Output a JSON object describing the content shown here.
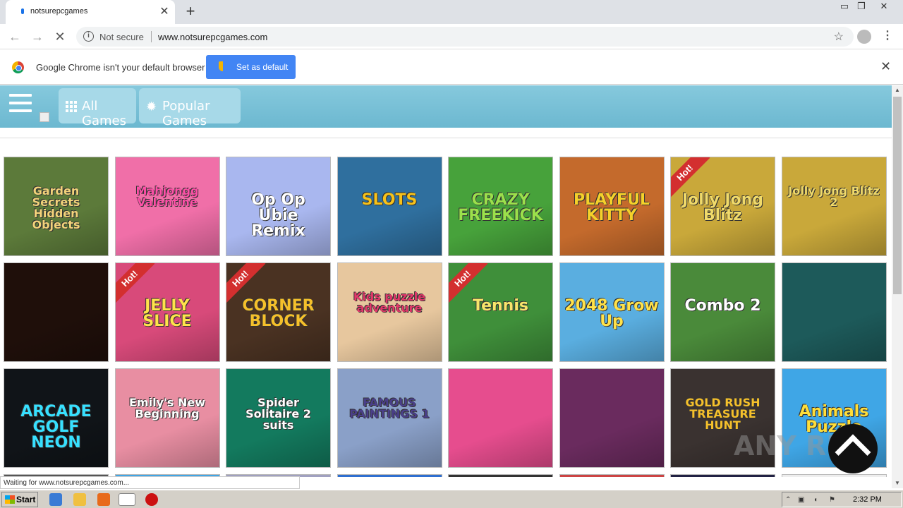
{
  "browser": {
    "tab_title": "notsurepcgames",
    "omnibox_security": "Not secure",
    "url": "www.notsurepcgames.com"
  },
  "infobar": {
    "message": "Google Chrome isn't your default browser",
    "button": "Set as default"
  },
  "site": {
    "nav": [
      {
        "label": "All Games",
        "icon": "grid-icon"
      },
      {
        "label": "Popular Games",
        "icon": "sun-icon"
      }
    ],
    "games": [
      {
        "title": "Garden Secrets Hidden Objects",
        "bg": "#5c7a3a",
        "color": "#f3d37a",
        "hot": false
      },
      {
        "title": "Mahjongg Valentine",
        "bg": "#f06fa8",
        "color": "#ff4fa8",
        "hot": false
      },
      {
        "title": "Op Op Ubie Remix",
        "bg": "#a9b7ef",
        "color": "#ffffff",
        "hot": false
      },
      {
        "title": "SLOTS",
        "bg": "#2f6f9e",
        "color": "#f7c21a",
        "hot": false
      },
      {
        "title": "CRAZY FREEKICK",
        "bg": "#47a23b",
        "color": "#9be04b",
        "hot": false
      },
      {
        "title": "PLAYFUL KITTY",
        "bg": "#c46a2c",
        "color": "#f5d12a",
        "hot": false
      },
      {
        "title": "Jolly Jong Blitz",
        "bg": "#c9a83a",
        "color": "#f0da6a",
        "hot": true
      },
      {
        "title": "Jolly Jong Blitz 2",
        "bg": "#c9a83a",
        "color": "#f0da6a",
        "hot": false
      },
      {
        "title": "",
        "bg": "#1f0f0a",
        "color": "#ffffff",
        "hot": false
      },
      {
        "title": "JELLY SLICE",
        "bg": "#d84a7a",
        "color": "#ffe34b",
        "hot": true
      },
      {
        "title": "CORNER BLOCK",
        "bg": "#4a3222",
        "color": "#f5c02b",
        "hot": true
      },
      {
        "title": "Kids puzzle adventure",
        "bg": "#e7c79e",
        "color": "#e2386a",
        "hot": false
      },
      {
        "title": "Tennis",
        "bg": "#3f8f3a",
        "color": "#f8e56a",
        "hot": true
      },
      {
        "title": "2048 Grow Up",
        "bg": "#5aaee0",
        "color": "#ffe24a",
        "hot": false
      },
      {
        "title": "Combo 2",
        "bg": "#4a8a3a",
        "color": "#ffffff",
        "hot": false
      },
      {
        "title": "",
        "bg": "#1d5a5a",
        "color": "#ffffff",
        "hot": false
      },
      {
        "title": "ARCADE GOLF NEON",
        "bg": "#101418",
        "color": "#37e0ff",
        "hot": false
      },
      {
        "title": "Emily's New Beginning",
        "bg": "#e88ea2",
        "color": "#ffffff",
        "hot": false
      },
      {
        "title": "Spider Solitaire 2 suits",
        "bg": "#137a5e",
        "color": "#ffffff",
        "hot": false
      },
      {
        "title": "FAMOUS PAINTINGS 1",
        "bg": "#8aa0c8",
        "color": "#4a3f8a",
        "hot": false
      },
      {
        "title": "",
        "bg": "#e64d8e",
        "color": "#ffffff",
        "hot": false
      },
      {
        "title": "",
        "bg": "#6a2b5e",
        "color": "#ffffff",
        "hot": false
      },
      {
        "title": "GOLD RUSH TREASURE HUNT",
        "bg": "#3a3230",
        "color": "#f5c02b",
        "hot": false
      },
      {
        "title": "Animals Puzzle",
        "bg": "#3fa6e6",
        "color": "#ffde3a",
        "hot": false
      }
    ],
    "hot_label": "Hot!",
    "tile_extra": {
      "combo": "Combo",
      "level": "2"
    }
  },
  "status_text": "Waiting for www.notsurepcgames.com...",
  "taskbar": {
    "start": "Start",
    "clock": "2:32 PM"
  },
  "watermark": "ANY RUN"
}
